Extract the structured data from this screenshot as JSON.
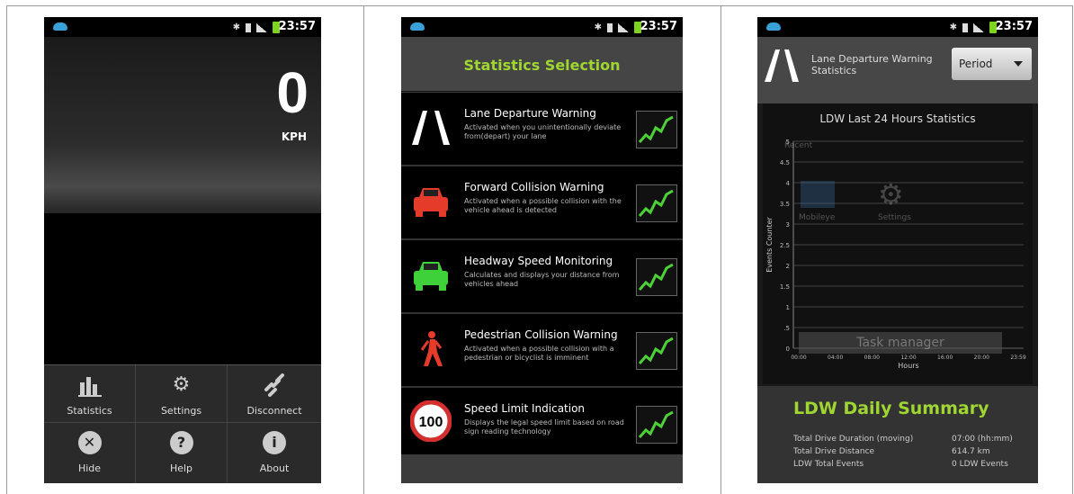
{
  "status": {
    "time": "23:57"
  },
  "screen1": {
    "speed": "0",
    "unit": "KPH",
    "menu": [
      {
        "label": "Statistics",
        "icon": "bar-chart-icon"
      },
      {
        "label": "Settings",
        "icon": "gear-icon"
      },
      {
        "label": "Disconnect",
        "icon": "broken-link-icon"
      },
      {
        "label": "Hide",
        "icon": "close-circle-icon"
      },
      {
        "label": "Help",
        "icon": "help-icon"
      },
      {
        "label": "About",
        "icon": "info-icon"
      }
    ]
  },
  "screen2": {
    "title": "Statistics Selection",
    "items": [
      {
        "title": "Lane Departure Warning",
        "desc": "Activated when you unintentionally deviate from(depart) your lane"
      },
      {
        "title": "Forward Collision Warning",
        "desc": "Activated when a possible collision with the vehicle ahead is detected"
      },
      {
        "title": "Headway Speed Monitoring",
        "desc": "Calculates and displays your distance from vehicles ahead"
      },
      {
        "title": "Pedestrian Collision Warning",
        "desc": "Activated when a possible collision with a pedestrian or bicyclist is imminent"
      },
      {
        "title": "Speed Limit Indication",
        "desc": "Displays the legal speed limit based on road sign reading technology",
        "sign": "100"
      }
    ]
  },
  "screen3": {
    "header_title": "Lane Departure Warning Statistics",
    "period_label": "Period",
    "chart_data": {
      "type": "line",
      "title": "LDW Last 24 Hours Statistics",
      "xlabel": "Hours",
      "ylabel": "Events Counter",
      "x_ticks": [
        "00:00",
        "04:00",
        "08:00",
        "12:00",
        "16:00",
        "20:00",
        "23:59"
      ],
      "y_ticks": [
        "0",
        ".5",
        "1",
        "1.5",
        "2",
        "2.5",
        "3",
        "3.5",
        "4",
        "4.5",
        "5"
      ],
      "ylim": [
        0,
        5
      ],
      "grid": true,
      "series": []
    },
    "overlay": {
      "recent": "Recent",
      "app1": "Mobileye",
      "app2": "Settings",
      "task_manager": "Task manager"
    },
    "summary": {
      "title": "LDW Daily Summary",
      "rows": [
        {
          "key": "Total Drive Duration (moving)",
          "value": "07:00 (hh:mm)"
        },
        {
          "key": "Total Drive Distance",
          "value": "614.7 km"
        },
        {
          "key": "LDW Total Events",
          "value": "0 LDW Events"
        }
      ]
    }
  }
}
